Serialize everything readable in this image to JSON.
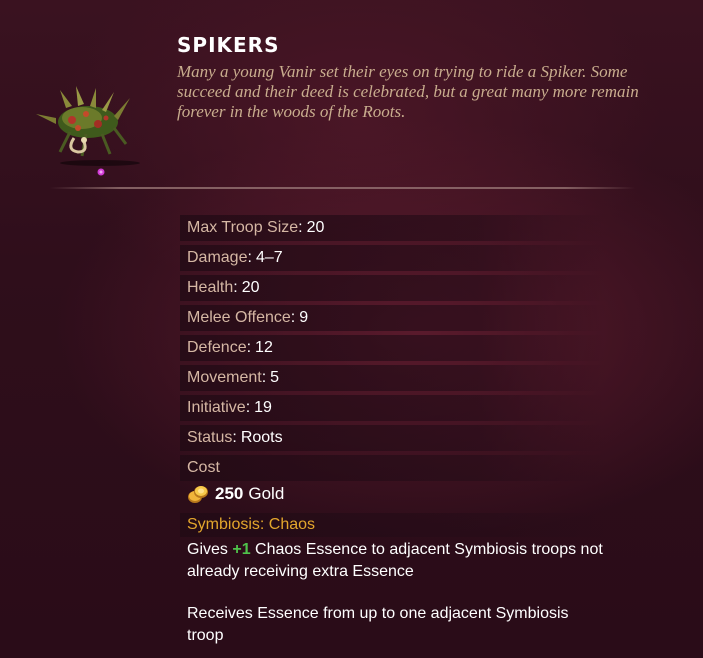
{
  "unit": {
    "name": "SPIKERS",
    "lore": "Many a young Vanir set their eyes on trying to ride a Spiker. Some succeed and their deed is celebrated, but a great many more remain forever in the woods of the Roots."
  },
  "stats": [
    {
      "label": "Max Troop Size",
      "value": "20"
    },
    {
      "label": "Damage",
      "value": "4–7"
    },
    {
      "label": "Health",
      "value": "20"
    },
    {
      "label": "Melee Offence",
      "value": "9"
    },
    {
      "label": "Defence",
      "value": "12"
    },
    {
      "label": "Movement",
      "value": "5"
    },
    {
      "label": "Initiative",
      "value": "19"
    },
    {
      "label": "Status",
      "value": "Roots"
    }
  ],
  "cost": {
    "label": "Cost",
    "amount": "250",
    "currency": "Gold",
    "icon": "gold-coins-icon"
  },
  "ability": {
    "name": "Symbiosis: Chaos",
    "line1_prefix": "Gives ",
    "line1_bonus": "+1",
    "line1_suffix": " Chaos Essence to adjacent Symbiosis troops not already receiving extra Essence",
    "line2": "Receives Essence from up to one adjacent Symbiosis troop"
  },
  "colors": {
    "label": "#d5b7a4",
    "value": "#ffffff",
    "ability_header": "#e3a62c",
    "bonus": "#4fc34b",
    "lore": "#c9ad8e"
  }
}
